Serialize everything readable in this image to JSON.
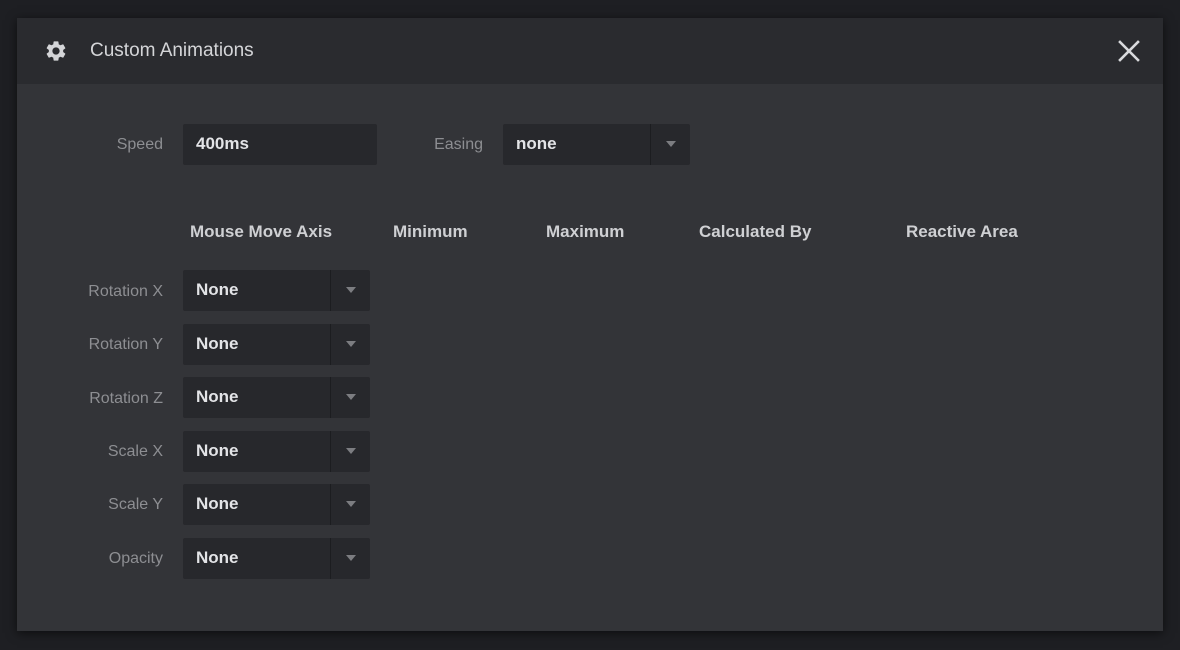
{
  "dialog": {
    "title": "Custom Animations",
    "gear_icon": "gear-icon",
    "close_icon": "close-icon"
  },
  "speed": {
    "label": "Speed",
    "value": "400ms"
  },
  "easing": {
    "label": "Easing",
    "value": "none"
  },
  "columns": {
    "mouse_move_axis": "Mouse Move Axis",
    "minimum": "Minimum",
    "maximum": "Maximum",
    "calculated_by": "Calculated By",
    "reactive_area": "Reactive Area"
  },
  "rows": [
    {
      "label": "Rotation X",
      "axis": "None"
    },
    {
      "label": "Rotation Y",
      "axis": "None"
    },
    {
      "label": "Rotation Z",
      "axis": "None"
    },
    {
      "label": "Scale X",
      "axis": "None"
    },
    {
      "label": "Scale Y",
      "axis": "None"
    },
    {
      "label": "Opacity",
      "axis": "None"
    }
  ],
  "colors": {
    "dialog_bg": "#333438",
    "header_bg": "#2a2b2f",
    "field_bg": "#27282c"
  }
}
